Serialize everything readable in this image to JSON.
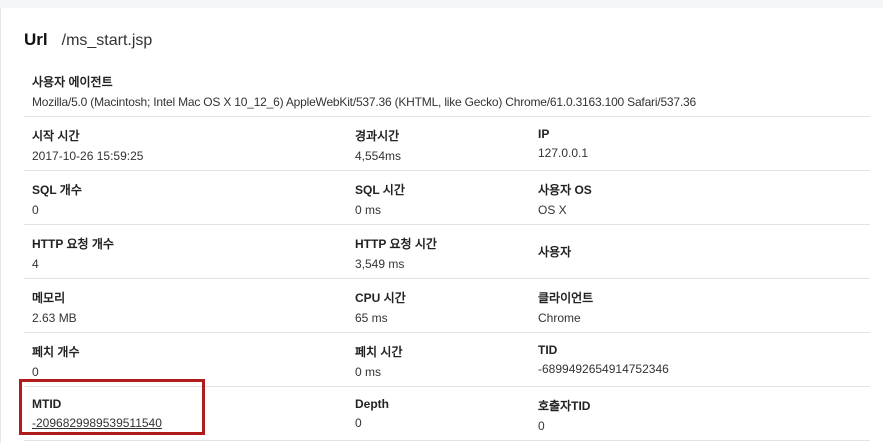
{
  "url": {
    "label": "Url",
    "value": "/ms_start.jsp"
  },
  "user_agent": {
    "label": "사용자 에이전트",
    "value": "Mozilla/5.0 (Macintosh; Intel Mac OS X 10_12_6) AppleWebKit/537.36 (KHTML, like Gecko) Chrome/61.0.3163.100 Safari/537.36"
  },
  "rows": [
    [
      {
        "label": "시작 시간",
        "value": "2017-10-26 15:59:25"
      },
      {
        "label": "경과시간",
        "value": "4,554ms"
      },
      {
        "label": "IP",
        "value": "127.0.0.1"
      }
    ],
    [
      {
        "label": "SQL 개수",
        "value": "0"
      },
      {
        "label": "SQL 시간",
        "value": "0 ms"
      },
      {
        "label": "사용자 OS",
        "value": "OS X"
      }
    ],
    [
      {
        "label": "HTTP 요청 개수",
        "value": "4"
      },
      {
        "label": "HTTP 요청 시간",
        "value": "3,549 ms"
      },
      {
        "label": "사용자",
        "value": ""
      }
    ],
    [
      {
        "label": "메모리",
        "value": "2.63 MB"
      },
      {
        "label": "CPU 시간",
        "value": "65 ms"
      },
      {
        "label": "클라이언트",
        "value": "Chrome"
      }
    ],
    [
      {
        "label": "페치 개수",
        "value": "0"
      },
      {
        "label": "페치 시간",
        "value": "0 ms"
      },
      {
        "label": "TID",
        "value": "-6899492654914752346"
      }
    ],
    [
      {
        "label": "MTID",
        "value": "-2096829989539511540"
      },
      {
        "label": "Depth",
        "value": "0"
      },
      {
        "label": "호출자TID",
        "value": "0"
      }
    ]
  ],
  "highlight_color": "#b01c1c"
}
